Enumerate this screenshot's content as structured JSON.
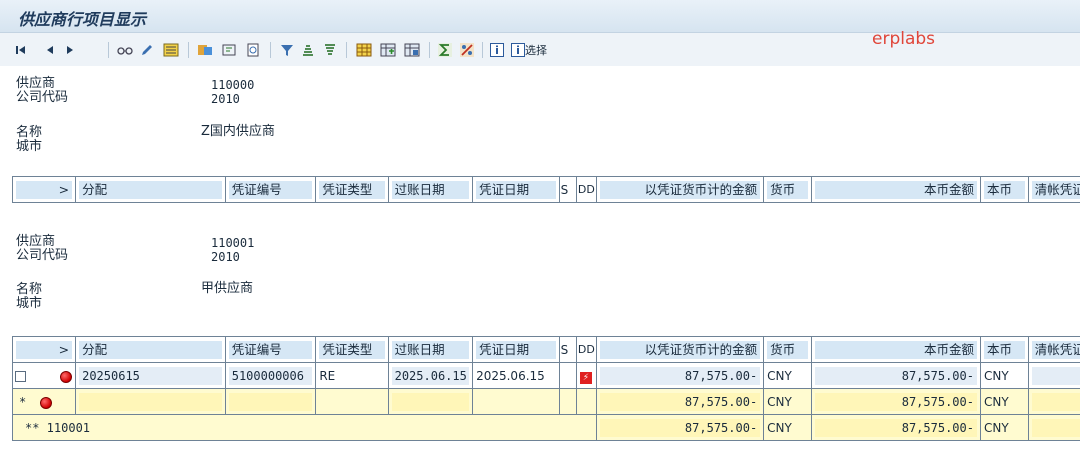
{
  "window": {
    "title": "供应商行项目显示"
  },
  "watermark": "erplabs",
  "toolbar": {
    "first_icon": "first-page-icon",
    "prev_icon": "previous-icon",
    "next_icon": "next-icon",
    "select_label": "选择"
  },
  "vendor1": {
    "labels": {
      "vendor": "供应商",
      "company_code": "公司代码",
      "name": "名称",
      "city": "城市"
    },
    "vendor": "110000",
    "company_code": "2010",
    "name": "Z国内供应商",
    "city": ""
  },
  "vendor2": {
    "labels": {
      "vendor": "供应商",
      "company_code": "公司代码",
      "name": "名称",
      "city": "城市"
    },
    "vendor": "110001",
    "company_code": "2010",
    "name": "甲供应商",
    "city": ""
  },
  "columns": {
    "arrow": ">",
    "assignment": "分配",
    "doc_no": "凭证编号",
    "doc_type": "凭证类型",
    "posting_date": "过账日期",
    "doc_date": "凭证日期",
    "s": "S",
    "dd": "DD",
    "amount_doc": "以凭证货币计的金额",
    "currency": "货币",
    "amount_local": "本币金额",
    "local_currency": "本币",
    "clearing_doc": "清帐凭证"
  },
  "rows": [
    {
      "assignment": "20250615",
      "doc_no": "5100000006",
      "doc_type": "RE",
      "posting_date": "2025.06.15",
      "doc_date": "2025.06.15",
      "amount_doc": "87,575.00-",
      "currency": "CNY",
      "amount_local": "87,575.00-",
      "local_currency": "CNY"
    }
  ],
  "subtotal": {
    "marker": "*",
    "amount_doc": "87,575.00-",
    "currency": "CNY",
    "amount_local": "87,575.00-",
    "local_currency": "CNY"
  },
  "total": {
    "label": "** 110001",
    "amount_doc": "87,575.00-",
    "currency": "CNY",
    "amount_local": "87,575.00-",
    "local_currency": "CNY"
  }
}
